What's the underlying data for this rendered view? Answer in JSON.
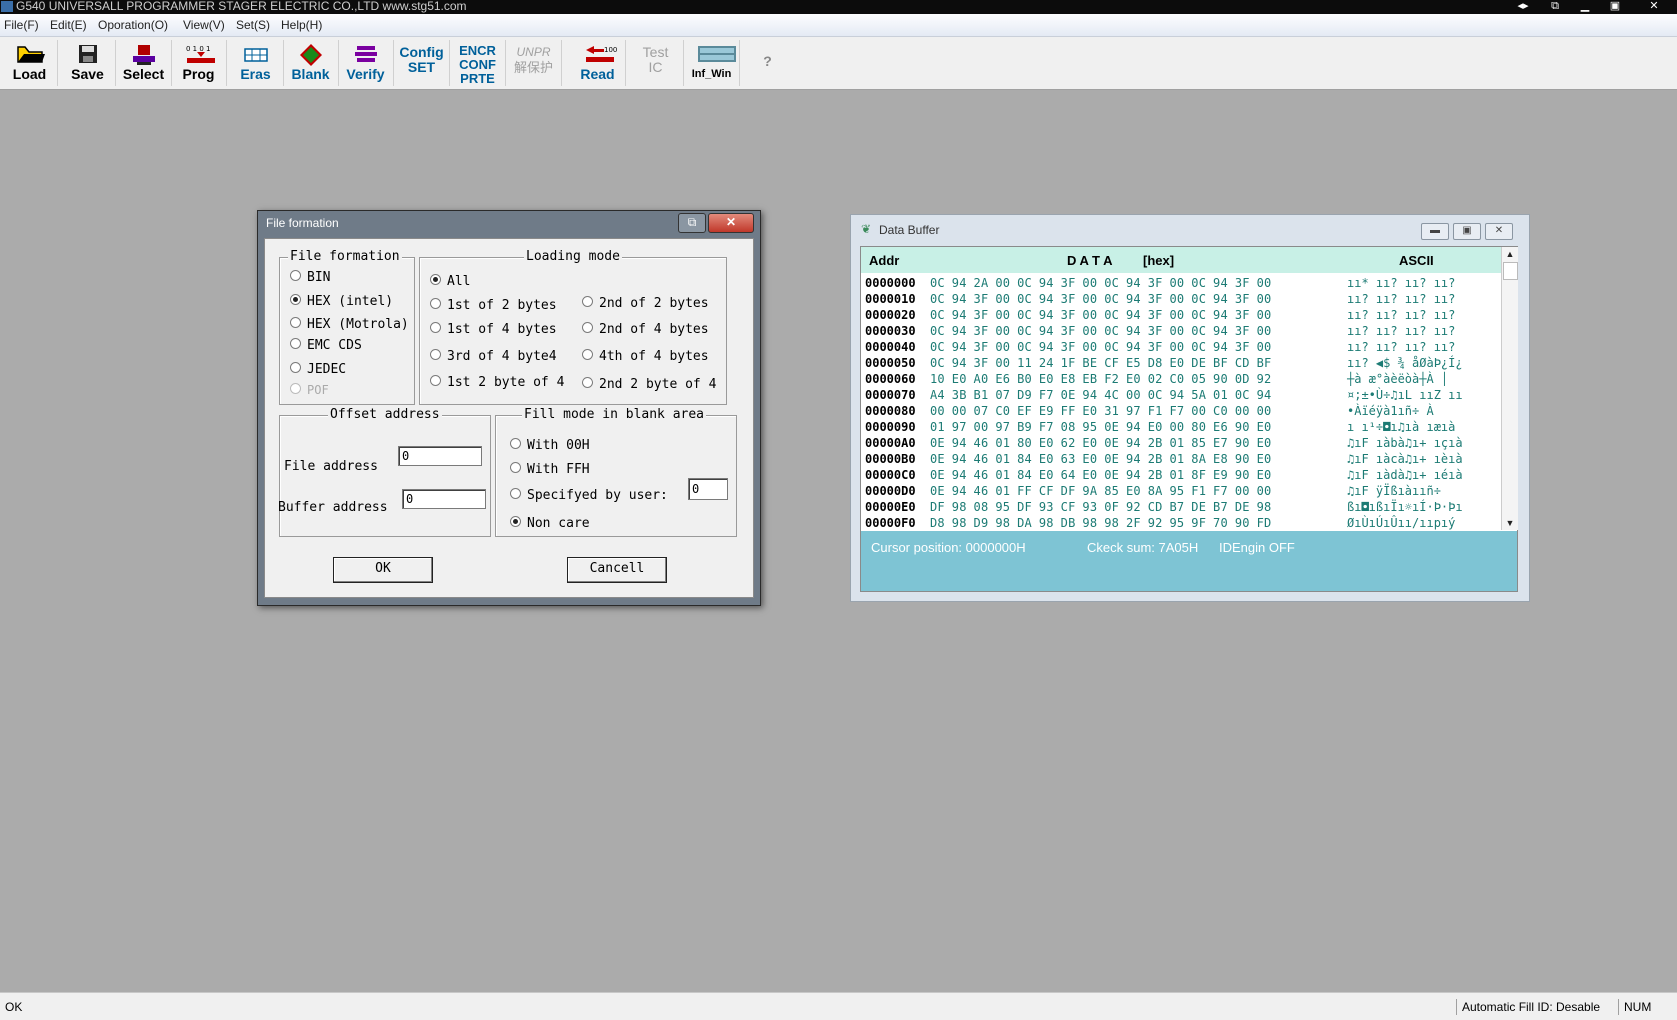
{
  "window": {
    "title": "G540 UNIVERSALL PROGRAMMER  STAGER ELECTRIC CO.,LTD   www.stg51.com"
  },
  "menu": [
    "File(F)",
    "Edit(E)",
    "Oporation(O)",
    "View(V)",
    "Set(S)",
    "Help(H)"
  ],
  "toolbar": {
    "load": "Load",
    "save": "Save",
    "select": "Select",
    "prog": "Prog",
    "eras": "Eras",
    "blank": "Blank",
    "verify": "Verify",
    "config": [
      "Config",
      "SET"
    ],
    "encr": [
      "ENCR",
      "CONF",
      "PRTE"
    ],
    "unpr": [
      "UNPR",
      "解保护"
    ],
    "read": "Read",
    "test": [
      "Test",
      "IC"
    ],
    "infwin": "Inf_Win",
    "help": "?"
  },
  "dialog": {
    "title": "File formation",
    "file_formation": {
      "legend": "File formation",
      "options": [
        "BIN",
        "HEX (intel)",
        "HEX (Motrola)",
        "EMC CDS",
        "JEDEC",
        "POF"
      ],
      "selected": "HEX (intel)"
    },
    "loading_mode": {
      "legend": "Loading mode",
      "all": "All",
      "options": [
        "1st of 2 bytes",
        "2nd of 2 bytes",
        "1st of 4 bytes",
        "2nd of 4 bytes",
        "3rd of 4 byte4",
        "4th of 4 bytes",
        "1st 2 byte of 4",
        "2nd 2 byte of 4"
      ],
      "selected": "All"
    },
    "offset": {
      "legend": "Offset address",
      "file_label": "File address",
      "file_value": "0",
      "buffer_label": "Buffer address",
      "buffer_value": "0"
    },
    "fill": {
      "legend": "Fill mode in blank area",
      "with00": "With 00H",
      "withFF": "With FFH",
      "user": "Specifyed by user:",
      "user_value": "0",
      "noncare": "Non care",
      "selected": "Non care"
    },
    "ok": "OK",
    "cancel": "Cancell"
  },
  "databuffer": {
    "title": "Data Buffer",
    "col_addr": "Addr",
    "col_data": "D A T A",
    "col_hex": "[hex]",
    "col_ascii": "ASCII",
    "rows": [
      {
        "addr": "0000000",
        "hex": "0C 94 2A 00 0C 94 3F 00 0C 94 3F 00 0C 94 3F 00",
        "ascii": "ıı* ıı? ıı? ıı?"
      },
      {
        "addr": "0000010",
        "hex": "0C 94 3F 00 0C 94 3F 00 0C 94 3F 00 0C 94 3F 00",
        "ascii": "ıı? ıı? ıı? ıı?"
      },
      {
        "addr": "0000020",
        "hex": "0C 94 3F 00 0C 94 3F 00 0C 94 3F 00 0C 94 3F 00",
        "ascii": "ıı? ıı? ıı? ıı?"
      },
      {
        "addr": "0000030",
        "hex": "0C 94 3F 00 0C 94 3F 00 0C 94 3F 00 0C 94 3F 00",
        "ascii": "ıı? ıı? ıı? ıı?"
      },
      {
        "addr": "0000040",
        "hex": "0C 94 3F 00 0C 94 3F 00 0C 94 3F 00 0C 94 3F 00",
        "ascii": "ıı? ıı? ıı? ıı?"
      },
      {
        "addr": "0000050",
        "hex": "0C 94 3F 00 11 24 1F BE CF E5 D8 E0 DE BF CD BF",
        "ascii": "ıı? ◀$ ¾ åØàÞ¿Í¿"
      },
      {
        "addr": "0000060",
        "hex": "10 E0 A0 E6 B0 E0 E8 EB F2 E0 02 C0 05 90 0D 92",
        "ascii": "┼à æ°àèëòà┼À │"
      },
      {
        "addr": "0000070",
        "hex": "A4 3B B1 07 D9 F7 0E 94 4C 00 0C 94 5A 01 0C 94",
        "ascii": "¤;±•Ù÷♫ıL ııZ ıı"
      },
      {
        "addr": "0000080",
        "hex": "00 00 07 C0 EF E9 FF E0 31 97 F1 F7 00 C0 00 00",
        "ascii": "•Àïéÿà1ıñ÷ À"
      },
      {
        "addr": "0000090",
        "hex": "01 97 00 97 B9 F7 08 95 0E 94 E0 00 80 E6 90 E0",
        "ascii": "ı ı¹÷◘ı♫ıà ıæıà"
      },
      {
        "addr": "00000A0",
        "hex": "0E 94 46 01 80 E0 62 E0 0E 94 2B 01 85 E7 90 E0",
        "ascii": "♫ıF ıàbà♫ı+ ıçıà"
      },
      {
        "addr": "00000B0",
        "hex": "0E 94 46 01 84 E0 63 E0 0E 94 2B 01 8A E8 90 E0",
        "ascii": "♫ıF ıàcà♫ı+ ıèıà"
      },
      {
        "addr": "00000C0",
        "hex": "0E 94 46 01 84 E0 64 E0 0E 94 2B 01 8F E9 90 E0",
        "ascii": "♫ıF ıàdà♫ı+ ıéıà"
      },
      {
        "addr": "00000D0",
        "hex": "0E 94 46 01 FF CF DF 9A 85 E0 8A 95 F1 F7 00 00",
        "ascii": "♫ıF ÿÏßıàııñ÷"
      },
      {
        "addr": "00000E0",
        "hex": "DF 98 08 95 DF 93 CF 93 0F 92 CD B7 DE B7 DE 98",
        "ascii": "ßı◘ıßıÏı☼ıÍ·Þ·Þı"
      },
      {
        "addr": "00000F0",
        "hex": "D8 98 D9 98 DA 98 DB 98 98 2F 92 95 9F 70 90 FD",
        "ascii": "ØıÙıÚıÛıı/ııpıý"
      }
    ],
    "status_cursor": "Cursor position:  0000000H",
    "status_checksum": "Ckeck sum:  7A05H",
    "status_idengin": "IDEngin OFF"
  },
  "statusbar": {
    "left": "OK",
    "autofill": "Automatic Fill ID: Desable",
    "num": "NUM"
  }
}
